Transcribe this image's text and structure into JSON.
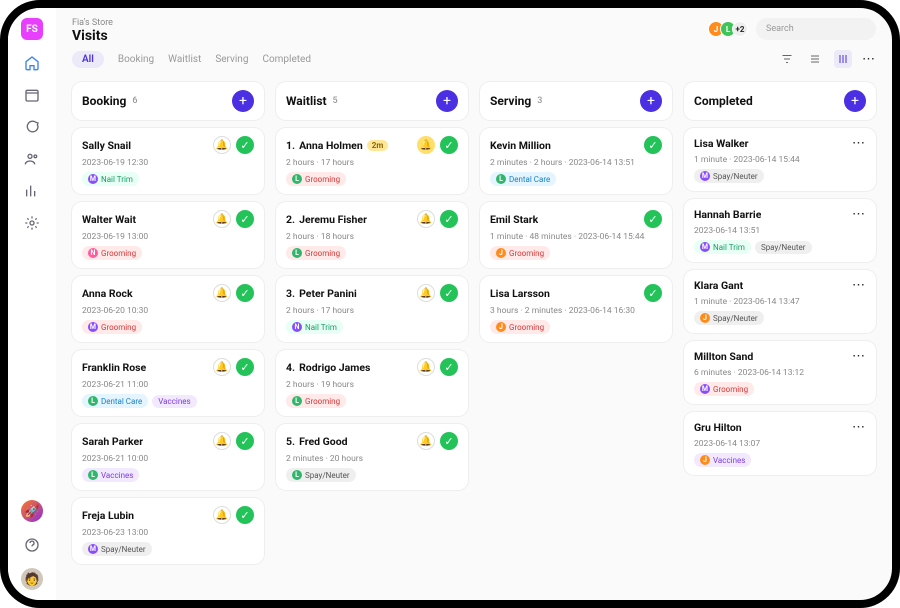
{
  "header": {
    "store": "Fia's Store",
    "page": "Visits",
    "avatars": [
      "J",
      "L",
      "+2"
    ],
    "search_placeholder": "Search"
  },
  "tabs": [
    "All",
    "Booking",
    "Waitlist",
    "Serving",
    "Completed"
  ],
  "columns": [
    {
      "title": "Booking",
      "count": "6",
      "cards": [
        {
          "name": "Sally Snail",
          "meta": "2023-06-19 12:30",
          "tags": [
            {
              "d": "M",
              "t": "Nail Trim",
              "c": "nailtrim"
            }
          ],
          "actions": "bellcheck"
        },
        {
          "name": "Walter Wait",
          "meta": "2023-06-19 13:00",
          "tags": [
            {
              "d": "N",
              "t": "Grooming",
              "c": "grooming"
            }
          ],
          "actions": "bellcheck"
        },
        {
          "name": "Anna Rock",
          "meta": "2023-06-20 10:30",
          "tags": [
            {
              "d": "M",
              "t": "Grooming",
              "c": "grooming"
            }
          ],
          "actions": "bellcheck"
        },
        {
          "name": "Franklin Rose",
          "meta": "2023-06-21 11:00",
          "tags": [
            {
              "d": "L",
              "t": "Dental Care",
              "c": "dental"
            },
            {
              "d": "",
              "t": "Vaccines",
              "c": "vaccines"
            }
          ],
          "actions": "bellcheck"
        },
        {
          "name": "Sarah Parker",
          "meta": "2023-06-21 10:00",
          "tags": [
            {
              "d": "L",
              "t": "Vaccines",
              "c": "vaccines"
            }
          ],
          "actions": "bellcheck"
        },
        {
          "name": "Freja Lubin",
          "meta": "2023-06-23 13:00",
          "tags": [
            {
              "d": "M",
              "t": "Spay/Neuter",
              "c": "spay"
            }
          ],
          "actions": "bellcheck"
        }
      ]
    },
    {
      "title": "Waitlist",
      "count": "5",
      "cards": [
        {
          "idx": "1.",
          "name": "Anna Holmen",
          "badge": "2m",
          "meta": "2 hours · 17 hours",
          "tags": [
            {
              "d": "L",
              "t": "Grooming",
              "c": "grooming"
            }
          ],
          "actions": "alertcheck"
        },
        {
          "idx": "2.",
          "name": "Jeremu Fisher",
          "meta": "2 hours · 18 hours",
          "tags": [
            {
              "d": "L",
              "t": "Grooming",
              "c": "grooming"
            }
          ],
          "actions": "bellcheck"
        },
        {
          "idx": "3.",
          "name": "Peter Panini",
          "meta": "2 hours · 17 hours",
          "tags": [
            {
              "d": "N",
              "t": "Nail Trim",
              "c": "nailtrim"
            }
          ],
          "actions": "bellcheck"
        },
        {
          "idx": "4.",
          "name": "Rodrigo James",
          "meta": "2 hours · 19 hours",
          "tags": [
            {
              "d": "L",
              "t": "Grooming",
              "c": "grooming"
            }
          ],
          "actions": "bellcheck"
        },
        {
          "idx": "5.",
          "name": "Fred Good",
          "meta": "2 minutes · 20 hours",
          "tags": [
            {
              "d": "L",
              "t": "Spay/Neuter",
              "c": "spay"
            }
          ],
          "actions": "bellcheck"
        }
      ]
    },
    {
      "title": "Serving",
      "count": "3",
      "cards": [
        {
          "name": "Kevin Million",
          "meta": "2 minutes · 2 hours · 2023-06-14 13:51",
          "tags": [
            {
              "d": "L",
              "t": "Dental Care",
              "c": "dental"
            }
          ],
          "actions": "check"
        },
        {
          "name": "Emil Stark",
          "meta": "1 minute · 48 minutes · 2023-06-14 15:44",
          "tags": [
            {
              "d": "J",
              "t": "Grooming",
              "c": "grooming"
            }
          ],
          "actions": "check"
        },
        {
          "name": "Lisa Larsson",
          "meta": "3 hours · 2 minutes · 2023-06-14 16:30",
          "tags": [
            {
              "d": "J",
              "t": "Grooming",
              "c": "grooming"
            }
          ],
          "actions": "check"
        }
      ]
    },
    {
      "title": "Completed",
      "count": "",
      "cards": [
        {
          "name": "Lisa Walker",
          "meta": "1 minute · 2023-06-14 15:44",
          "tags": [
            {
              "d": "M",
              "t": "Spay/Neuter",
              "c": "spay"
            }
          ],
          "actions": "more"
        },
        {
          "name": "Hannah Barrie",
          "meta": "2023-06-14 13:51",
          "tags": [
            {
              "d": "M",
              "t": "Nail Trim",
              "c": "nailtrim"
            },
            {
              "d": "",
              "t": "Spay/Neuter",
              "c": "spay"
            }
          ],
          "actions": "more"
        },
        {
          "name": "Klara Gant",
          "meta": "1 minute · 2023-06-14 13:47",
          "tags": [
            {
              "d": "J",
              "t": "Spay/Neuter",
              "c": "spay"
            }
          ],
          "actions": "more"
        },
        {
          "name": "Millton Sand",
          "meta": "6 minutes · 2023-06-14 13:12",
          "tags": [
            {
              "d": "M",
              "t": "Grooming",
              "c": "grooming"
            }
          ],
          "actions": "more"
        },
        {
          "name": "Gru Hilton",
          "meta": "2023-06-14 13:07",
          "tags": [
            {
              "d": "J",
              "t": "Vaccines",
              "c": "vaccines"
            }
          ],
          "actions": "more"
        }
      ]
    }
  ],
  "store_code": "FS"
}
